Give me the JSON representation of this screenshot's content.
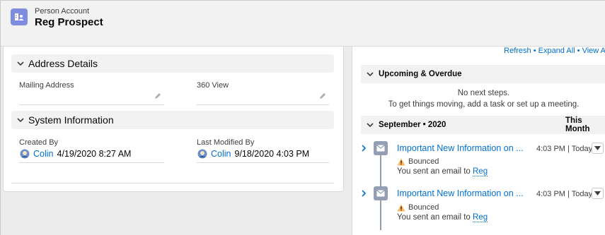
{
  "header": {
    "object_type": "Person Account",
    "record_name": "Reg Prospect",
    "icon": "person-account-icon",
    "icon_color": "#7f8de1"
  },
  "details": {
    "address_section": "Address Details",
    "mailing_address_label": "Mailing Address",
    "view360_label": "360 View",
    "system_section": "System Information",
    "created_by_label": "Created By",
    "created_by_user": "Colin",
    "created_by_date": "4/19/2020 8:27 AM",
    "modified_by_label": "Last Modified By",
    "modified_by_user": "Colin",
    "modified_by_date": "9/18/2020 4:03 PM"
  },
  "activity": {
    "top_links": "Refresh • Expand All • View A",
    "upcoming_title": "Upcoming & Overdue",
    "no_steps_1": "No next steps.",
    "no_steps_2": "To get things moving, add a task or set up a meeting.",
    "month_title": "September • 2020",
    "month_right": "This Month",
    "items": [
      {
        "title": "Important New Information on ...",
        "time": "4:03 PM | Today",
        "status": "Bounced",
        "sent_prefix": "You sent an email to",
        "recipient": "Reg"
      },
      {
        "title": "Important New Information on ...",
        "time": "4:03 PM | Today",
        "status": "Bounced",
        "sent_prefix": "You sent an email to",
        "recipient": "Reg"
      }
    ]
  },
  "colors": {
    "link": "#0070d2",
    "timeline_email": "#939eb3",
    "warning": "#ffb75d"
  }
}
